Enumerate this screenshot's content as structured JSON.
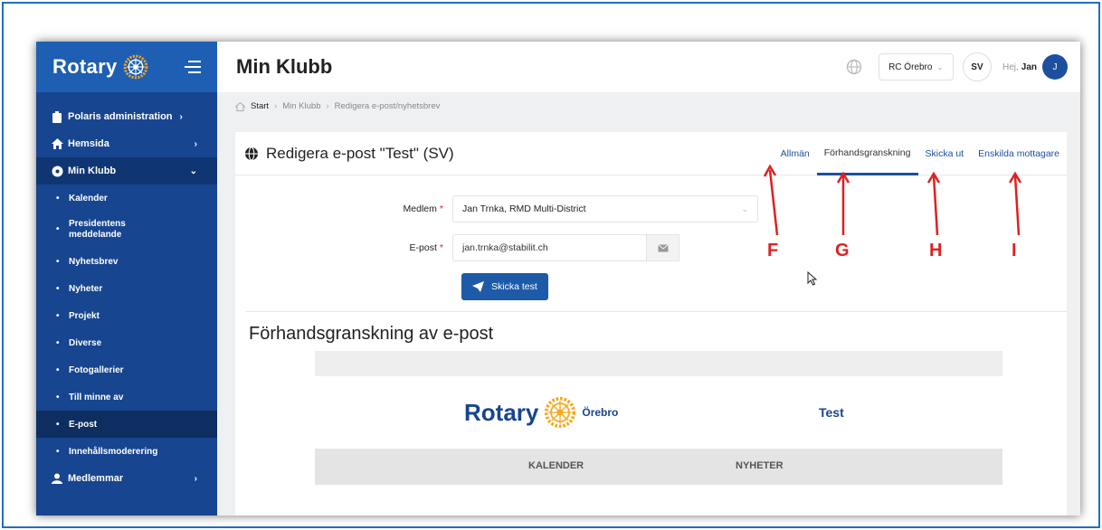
{
  "sidebar": {
    "brand": "Rotary",
    "items": [
      {
        "label": "Polaris administration",
        "icon": "clipboard-icon"
      },
      {
        "label": "Hemsida",
        "icon": "home-icon"
      },
      {
        "label": "Min Klubb",
        "icon": "rotary-icon"
      }
    ],
    "sub_items": [
      "Kalender",
      "Presidentens",
      "meddelande",
      "Nyhetsbrev",
      "Nyheter",
      "Projekt",
      "Diverse",
      "Fotogallerier",
      "Till minne av",
      "E-post",
      "Innehållsmoderering"
    ],
    "bottom_item": "Medlemmar"
  },
  "header": {
    "title": "Min Klubb",
    "club": "RC Örebro",
    "lang": "SV",
    "greeting": "Hej,",
    "user": "Jan",
    "avatar_initial": "J"
  },
  "breadcrumb": [
    "Start",
    "Min Klubb",
    "Redigera e-post/nyhetsbrev"
  ],
  "card": {
    "title": "Redigera e-post \"Test\" (SV)",
    "tabs": [
      "Allmän",
      "Förhandsgranskning",
      "Skicka ut",
      "Enskilda mottagare"
    ]
  },
  "form": {
    "member_label": "Medlem",
    "member_value": "Jan Trnka, RMD Multi-District",
    "email_label": "E-post",
    "email_value": "jan.trnka@stabilit.ch",
    "required_mark": "*",
    "send_test": "Skicka test"
  },
  "preview": {
    "heading": "Förhandsgranskning av e-post",
    "brand": "Rotary",
    "city": "Örebro",
    "subject": "Test",
    "nav": [
      "KALENDER",
      "NYHETER"
    ]
  },
  "annotations": [
    "F",
    "G",
    "H",
    "I"
  ],
  "colors": {
    "sidebar": "#17458f",
    "accent": "#1d5aa8",
    "annotation": "#e02020"
  }
}
